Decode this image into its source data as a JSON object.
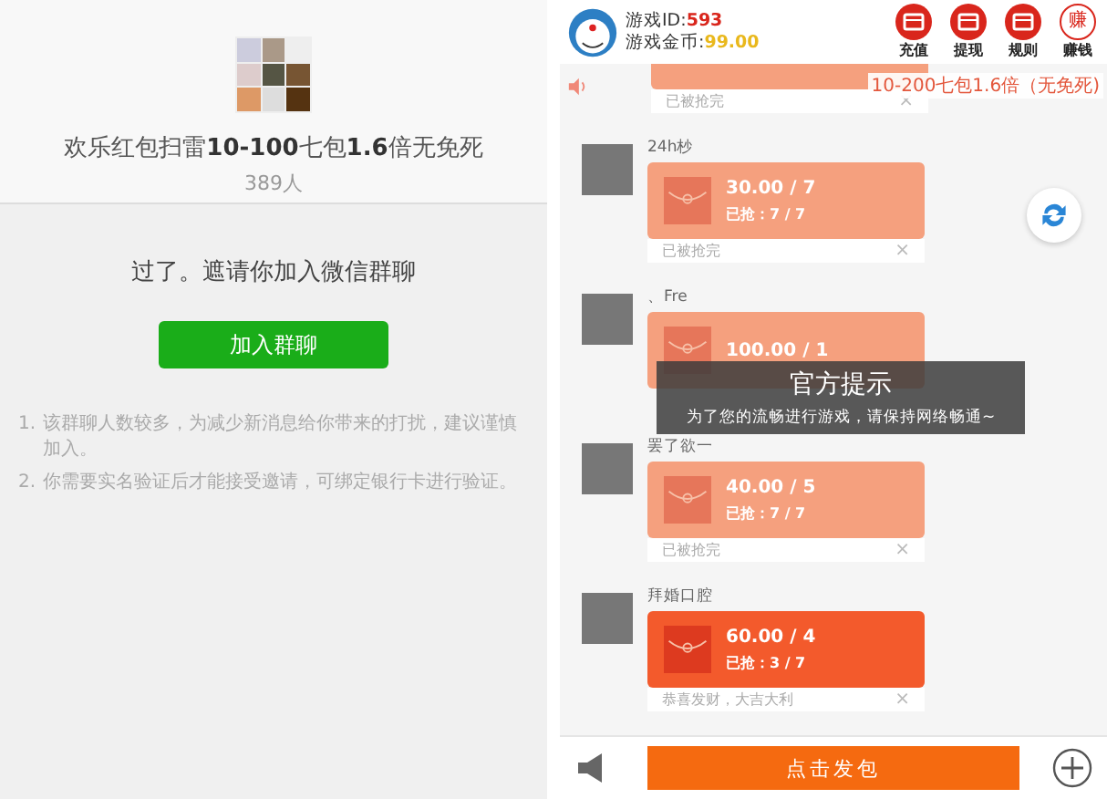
{
  "invite_panel": {
    "group_title": "欢乐红包扫雷**10-100**七包**1.6**倍无免死",
    "member_count": "389人",
    "message": "过了。遮请你加入微信群聊",
    "join_button": "加入群聊",
    "notes": [
      {
        "number": "1.",
        "text": "该群聊人数较多，为减少新消息给你带来的打扰，建议谨慎加入。"
      },
      {
        "number": "2.",
        "text": "你需要实名验证后才能接受邀请，可绑定银行卡进行验证。"
      }
    ]
  },
  "game_panel": {
    "header": {
      "id_label": "游戏ID:",
      "id_value": "593",
      "coins_label": "游戏金币:",
      "coins_value": "99.00",
      "actions": [
        {
          "kind": "filled",
          "label": "充值"
        },
        {
          "kind": "filled",
          "label": "提现"
        },
        {
          "kind": "filled",
          "label": "规则"
        },
        {
          "kind": "outline",
          "label": "赚钱",
          "badge": "赚"
        }
      ]
    },
    "marquee": "10-200七包1.6倍（无免死)",
    "messages": [
      {
        "kind": "partial",
        "opened": true,
        "footer": "已被抢完",
        "close": "×"
      },
      {
        "kind": "packet",
        "opened": true,
        "name": "24h杪",
        "amount": "30.00 / 7",
        "grabbed": "已抢：7 / 7",
        "footer": "已被抢完",
        "close": "×"
      },
      {
        "kind": "packet",
        "opened": true,
        "name": "、Fre",
        "amount": "100.00 / 1"
      },
      {
        "kind": "packet",
        "opened": true,
        "name": "罢了欲一",
        "amount": "40.00 / 5",
        "grabbed": "已抢：7 / 7",
        "footer": "已被抢完",
        "close": "×"
      },
      {
        "kind": "packet",
        "opened": false,
        "name": "拜婚口腔",
        "amount": "60.00 / 4",
        "grabbed": "已抢：3 / 7",
        "footer": "恭喜发财，大吉大利",
        "close": "×"
      }
    ],
    "toast": {
      "title": "官方提示",
      "text": "为了您的流畅进行游戏，请保持网络畅通~"
    },
    "send_button": "点击发包"
  }
}
